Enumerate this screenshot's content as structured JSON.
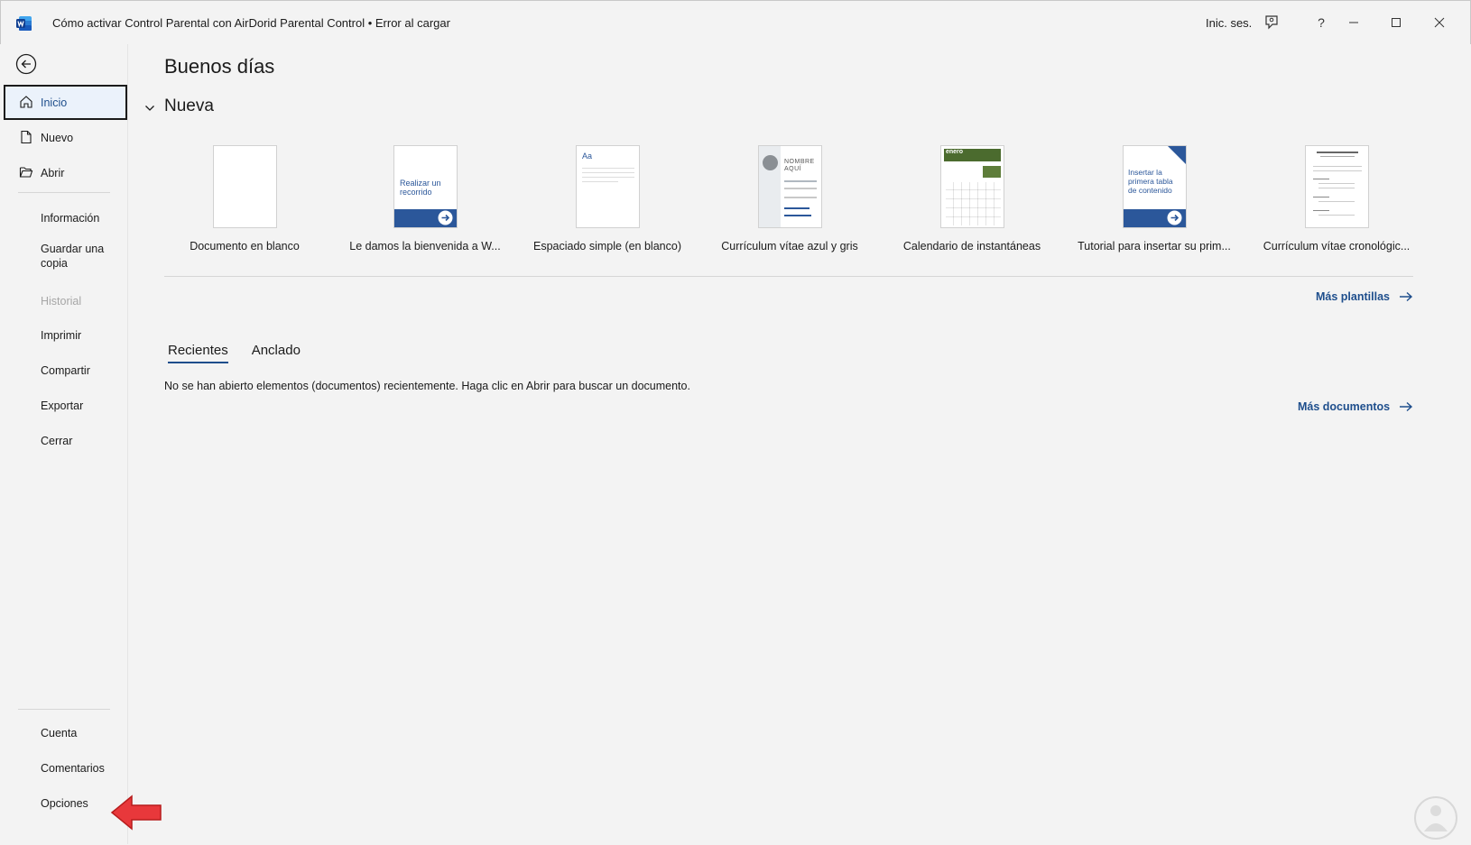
{
  "window": {
    "title": "Cómo activar Control Parental con AirDorid Parental Control • Error al cargar",
    "sign_in": "Inic. ses.",
    "help": "?"
  },
  "sidebar": {
    "items": [
      {
        "label": "Inicio",
        "icon": "home-icon",
        "state": "active"
      },
      {
        "label": "Nuevo",
        "icon": "new-document-icon"
      },
      {
        "label": "Abrir",
        "icon": "folder-open-icon"
      },
      {
        "label": "Información"
      },
      {
        "label": "Guardar una copia"
      },
      {
        "label": "Historial",
        "state": "disabled"
      },
      {
        "label": "Imprimir"
      },
      {
        "label": "Compartir"
      },
      {
        "label": "Exportar"
      },
      {
        "label": "Cerrar"
      }
    ],
    "bottom_items": [
      {
        "label": "Cuenta"
      },
      {
        "label": "Comentarios"
      },
      {
        "label": "Opciones"
      }
    ]
  },
  "main": {
    "greeting": "Buenos días",
    "new_section": "Nueva",
    "templates": [
      {
        "caption": "Documento en blanco"
      },
      {
        "caption": "Le damos la bienvenida a W...",
        "thumb_text": "Realizar un recorrido"
      },
      {
        "caption": "Espaciado simple (en blanco)",
        "thumb_text": "Aa"
      },
      {
        "caption": "Currículum vítae azul y gris",
        "thumb_text": "NOMBRE AQUÍ"
      },
      {
        "caption": "Calendario de instantáneas",
        "thumb_text": "enero"
      },
      {
        "caption": "Tutorial para insertar su prim...",
        "thumb_text": "Insertar la primera tabla de contenido"
      },
      {
        "caption": "Currículum vítae cronológic..."
      }
    ],
    "more_templates": "Más plantillas",
    "tabs": [
      "Recientes",
      "Anclado"
    ],
    "empty_message": "No se han abierto elementos (documentos) recientemente. Haga clic en Abrir para buscar un documento.",
    "more_documents": "Más documentos"
  },
  "colors": {
    "accent": "#1e4e8c",
    "word_blue": "#2b579a",
    "annotation_red": "#e8383b"
  }
}
